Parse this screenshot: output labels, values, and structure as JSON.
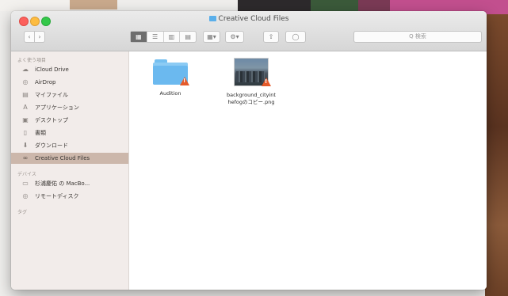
{
  "window": {
    "title": "Creative Cloud Files"
  },
  "toolbar": {
    "back_glyph": "‹",
    "forward_glyph": "›",
    "view_icons": [
      "▦",
      "☰",
      "▥",
      "▤"
    ],
    "arrange_glyph": "▦▾",
    "action_glyph": "⚙▾",
    "share_glyph": "⇧",
    "tag_glyph": "◯",
    "search_placeholder": "Q 検索"
  },
  "sidebar": {
    "favorites_header": "よく使う項目",
    "favorites": [
      {
        "label": "iCloud Drive",
        "icon": "cloud-icon",
        "glyph": "☁"
      },
      {
        "label": "AirDrop",
        "icon": "airdrop-icon",
        "glyph": "◎"
      },
      {
        "label": "マイファイル",
        "icon": "all-files-icon",
        "glyph": "▤"
      },
      {
        "label": "アプリケーション",
        "icon": "applications-icon",
        "glyph": "A"
      },
      {
        "label": "デスクトップ",
        "icon": "desktop-icon",
        "glyph": "▣"
      },
      {
        "label": "書類",
        "icon": "documents-icon",
        "glyph": "▯"
      },
      {
        "label": "ダウンロード",
        "icon": "downloads-icon",
        "glyph": "⬇"
      },
      {
        "label": "Creative Cloud Files",
        "icon": "creative-cloud-icon",
        "glyph": "∞"
      }
    ],
    "devices_header": "デバイス",
    "devices": [
      {
        "label": "杉浦慶佑 の MacBo...",
        "icon": "laptop-icon",
        "glyph": "▭"
      },
      {
        "label": "リモートディスク",
        "icon": "remote-disc-icon",
        "glyph": "◎"
      }
    ],
    "tags_header": "タグ"
  },
  "files": [
    {
      "name": "Audition",
      "kind": "folder",
      "icon": "folder-icon",
      "badge": "warning-icon"
    },
    {
      "name": "background_cityint\nhefogのコピー.png",
      "line1": "background_cityint",
      "line2": "hefogのコピー.png",
      "kind": "image",
      "icon": "image-thumbnail-icon",
      "badge": "warning-icon"
    }
  ],
  "colors": {
    "selected_sidebar": "#ccb7ab",
    "folder_blue": "#6bb9ef",
    "warning": "#e45a2a"
  }
}
